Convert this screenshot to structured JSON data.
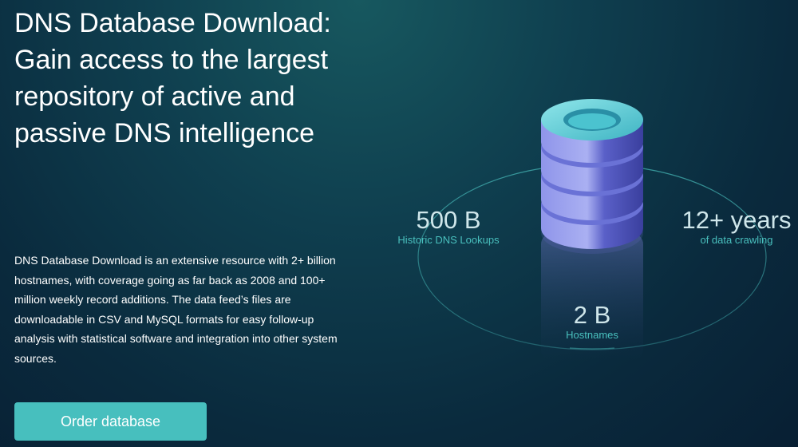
{
  "hero": {
    "title": "DNS Database Download: Gain access to the largest repository of active and passive DNS intelligence",
    "description": "DNS Database Download is an extensive resource with 2+ billion hostnames, with coverage going as far back as 2008 and 100+ million weekly record additions. The data feed’s files are downloadable in CSV and MySQL formats for easy follow-up analysis with statistical software and integration into other system sources.",
    "cta_label": "Order database"
  },
  "illustration": {
    "icon": "database-stack-icon",
    "stats": {
      "lookups": {
        "value": "500 B",
        "label": "Historic DNS Lookups"
      },
      "years": {
        "value": "12+ years",
        "label": "of data crawling"
      },
      "hostnames": {
        "value": "2 B",
        "label": "Hostnames"
      }
    }
  },
  "colors": {
    "accent": "#47bfbe",
    "background": "#0a2a3d",
    "disk_light": "#a2a7ef",
    "disk_top": "#5fd0d8"
  }
}
